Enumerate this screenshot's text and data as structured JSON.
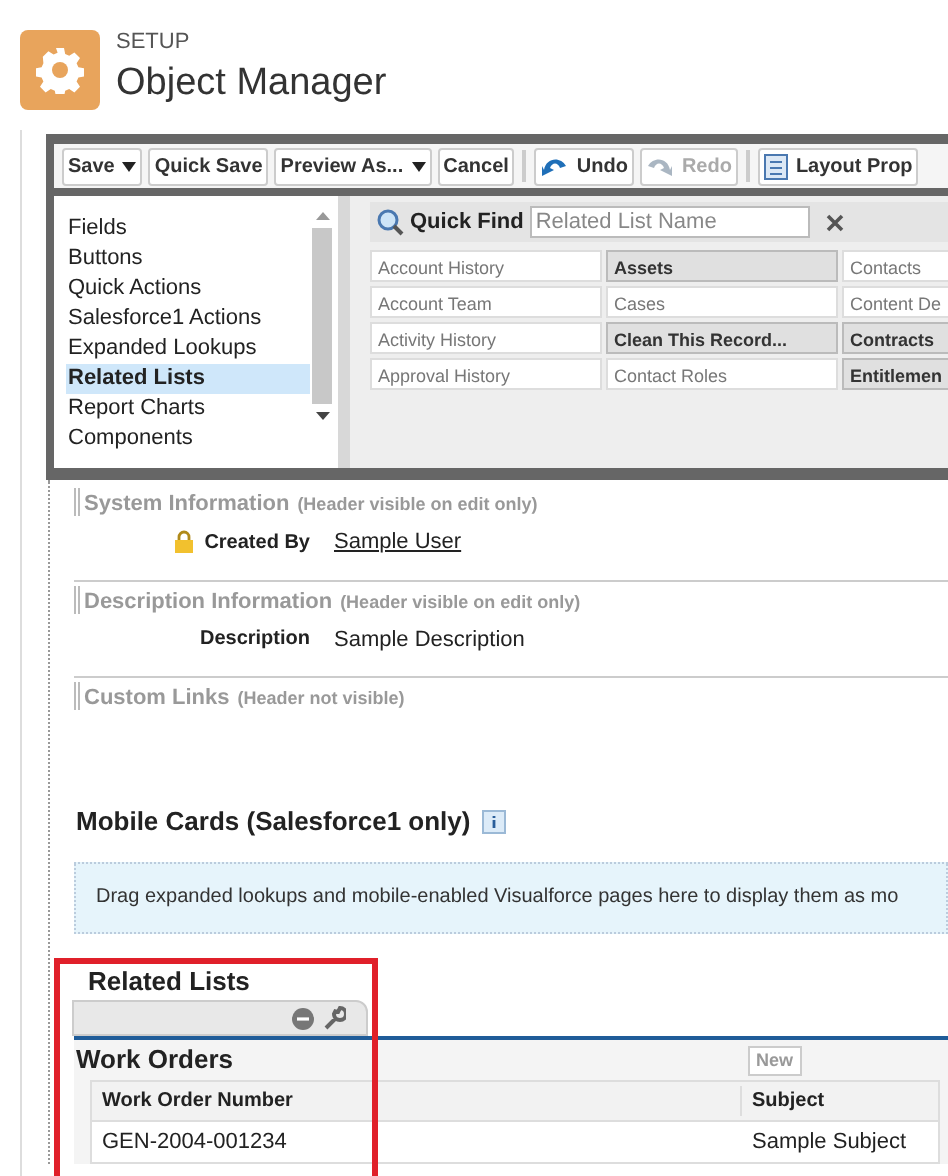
{
  "header": {
    "section": "SETUP",
    "title": "Object Manager"
  },
  "toolbar": [
    {
      "label": "Save",
      "kind": "button",
      "dropdown": true,
      "disabled": false
    },
    {
      "label": "Quick Save",
      "kind": "button",
      "dropdown": false,
      "disabled": false
    },
    {
      "label": "Preview As...",
      "kind": "button",
      "dropdown": true,
      "disabled": false
    },
    {
      "label": "Cancel",
      "kind": "button",
      "dropdown": false,
      "disabled": false
    },
    {
      "kind": "separator"
    },
    {
      "label": "Undo",
      "kind": "undo",
      "dropdown": false,
      "disabled": false
    },
    {
      "label": "Redo",
      "kind": "redo",
      "dropdown": false,
      "disabled": true
    },
    {
      "kind": "separator"
    },
    {
      "label": "Layout Prop",
      "kind": "properties",
      "dropdown": false,
      "disabled": false
    }
  ],
  "sidebar": {
    "items": [
      {
        "label": "Fields",
        "selected": false
      },
      {
        "label": "Buttons",
        "selected": false
      },
      {
        "label": "Quick Actions",
        "selected": false
      },
      {
        "label": "Salesforce1 Actions",
        "selected": false
      },
      {
        "label": "Expanded Lookups",
        "selected": false
      },
      {
        "label": "Related Lists",
        "selected": true
      },
      {
        "label": "Report Charts",
        "selected": false
      },
      {
        "label": "Components",
        "selected": false
      }
    ]
  },
  "quick_find": {
    "label": "Quick Find",
    "placeholder": "Related List Name"
  },
  "palette": {
    "rows": [
      [
        {
          "label": "Account History",
          "disabled": true
        },
        {
          "label": "Assets",
          "disabled": false
        },
        {
          "label": "Contacts",
          "disabled": true
        }
      ],
      [
        {
          "label": "Account Team",
          "disabled": true
        },
        {
          "label": "Cases",
          "disabled": true
        },
        {
          "label": "Content De",
          "disabled": true
        }
      ],
      [
        {
          "label": "Activity History",
          "disabled": true
        },
        {
          "label": "Clean This Record...",
          "disabled": false
        },
        {
          "label": "Contracts",
          "disabled": false
        }
      ],
      [
        {
          "label": "Approval History",
          "disabled": true
        },
        {
          "label": "Contact Roles",
          "disabled": true
        },
        {
          "label": "Entitlemen",
          "disabled": false
        }
      ]
    ]
  },
  "sections": [
    {
      "title": "System Information",
      "hint": "(Header visible on edit only)",
      "fields": [
        {
          "label": "Created By",
          "value": "Sample User",
          "locked": true,
          "link": true
        }
      ]
    },
    {
      "title": "Description Information",
      "hint": "(Header visible on edit only)",
      "fields": [
        {
          "label": "Description",
          "value": "Sample Description",
          "locked": false,
          "link": false
        }
      ]
    },
    {
      "title": "Custom Links",
      "hint": "(Header not visible)"
    }
  ],
  "mobile_cards": {
    "title": "Mobile Cards (Salesforce1 only)",
    "hint": "Drag expanded lookups and mobile-enabled Visualforce pages here to display them as mo"
  },
  "related_lists": {
    "title": "Related Lists",
    "lists": [
      {
        "title": "Work Orders",
        "button": "New",
        "columns": [
          "Work Order Number",
          "Subject"
        ],
        "rows": [
          [
            "GEN-2004-001234",
            "Sample Subject"
          ]
        ]
      }
    ]
  }
}
